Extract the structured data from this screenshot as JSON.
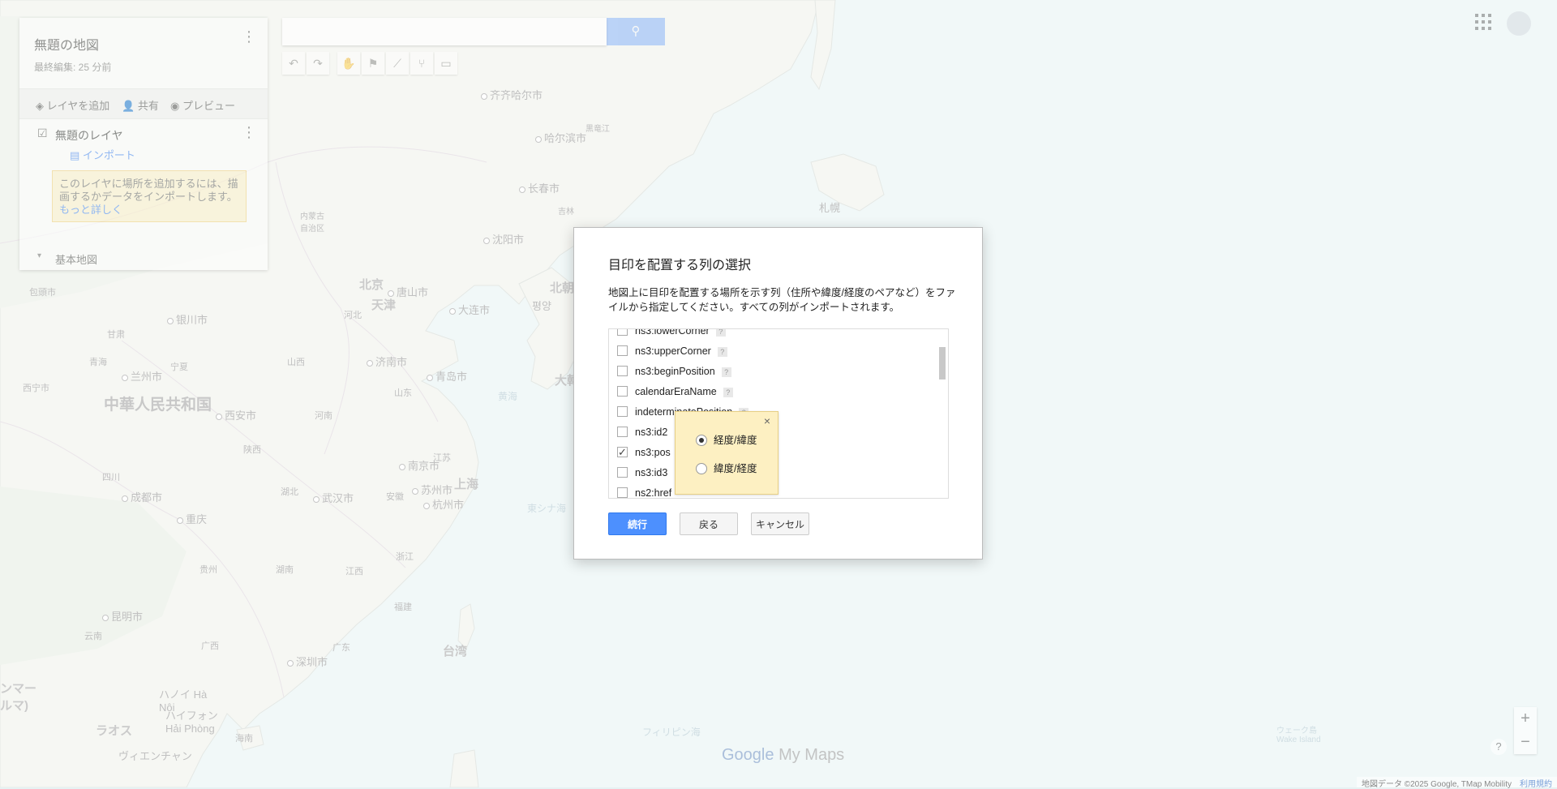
{
  "map": {
    "places": [
      {
        "label": "齐齐哈尔市"
      },
      {
        "label": "哈尔滨市"
      },
      {
        "label": "长春市"
      },
      {
        "label": "沈阳市"
      },
      {
        "label": "北京"
      },
      {
        "label": "天津"
      },
      {
        "label": "唐山市"
      },
      {
        "label": "大连市"
      },
      {
        "label": "银川市"
      },
      {
        "label": "兰州市"
      },
      {
        "label": "西安市"
      },
      {
        "label": "济南市"
      },
      {
        "label": "青岛市"
      },
      {
        "label": "南京市"
      },
      {
        "label": "苏州市"
      },
      {
        "label": "上海"
      },
      {
        "label": "杭州市"
      },
      {
        "label": "武汉市"
      },
      {
        "label": "成都市"
      },
      {
        "label": "重庆"
      },
      {
        "label": "昆明市"
      },
      {
        "label": "深圳市"
      },
      {
        "label": "台湾"
      },
      {
        "label": "札幌"
      },
      {
        "label": "평양"
      },
      {
        "label": "ハノイ Hà Nội"
      },
      {
        "label": "ハイフォン Hải Phòng"
      },
      {
        "label": "ラオス"
      },
      {
        "label": "ヴィエンチャン"
      },
      {
        "label": "フィリピン海"
      },
      {
        "label": "ウェーク島 Wake Island"
      },
      {
        "label": "内蒙古 自治区"
      },
      {
        "label": "吉林"
      },
      {
        "label": "黒竜江"
      },
      {
        "label": "北朝"
      },
      {
        "label": "大韓"
      },
      {
        "label": "東シナ海"
      },
      {
        "label": "黄海"
      },
      {
        "label": "海南"
      },
      {
        "label": "广西"
      },
      {
        "label": "贵州"
      },
      {
        "label": "湖南"
      },
      {
        "label": "江西"
      },
      {
        "label": "福建"
      },
      {
        "label": "广东"
      },
      {
        "label": "湖北"
      },
      {
        "label": "安徽"
      },
      {
        "label": "江苏"
      },
      {
        "label": "山西"
      },
      {
        "label": "河北"
      },
      {
        "label": "陕西"
      },
      {
        "label": "甘肃"
      },
      {
        "label": "宁夏"
      },
      {
        "label": "青海"
      },
      {
        "label": "四川"
      },
      {
        "label": "云南"
      },
      {
        "label": "浙江"
      },
      {
        "label": "山东"
      },
      {
        "label": "河南"
      },
      {
        "label": "包頭市"
      },
      {
        "label": "西宁市"
      }
    ],
    "country_label": "中華人民共和国",
    "myanmar_label": "ンマー\nルマ)",
    "brand_google": "Google",
    "brand_product": "My Maps",
    "attribution": "地図データ ©2025 Google, TMap Mobility",
    "terms": "利用規約",
    "zoom_in": "+",
    "zoom_out": "−",
    "help": "?"
  },
  "left_panel": {
    "map_title": "無題の地図",
    "last_edited": "最終編集: 25 分前",
    "add_layer": "レイヤを追加",
    "share": "共有",
    "preview": "プレビュー",
    "layer_title": "無題のレイヤ",
    "import": "インポート",
    "hint_text": "このレイヤに場所を追加するには、描画するかデータをインポートします。",
    "hint_link": "もっと詳しく",
    "base_map": "基本地図"
  },
  "search": {
    "placeholder": ""
  },
  "dialog": {
    "title": "目印を配置する列の選択",
    "description": "地図上に目印を配置する場所を示す列（住所や緯度/経度のペアなど）をファイルから指定してください。すべての列がインポートされます。",
    "columns": [
      {
        "name": "ns3:lowerCorner",
        "checked": false
      },
      {
        "name": "ns3:upperCorner",
        "checked": false
      },
      {
        "name": "ns3:beginPosition",
        "checked": false
      },
      {
        "name": "calendarEraName",
        "checked": false
      },
      {
        "name": "indeterminatePosition",
        "checked": false
      },
      {
        "name": "ns3:id2",
        "checked": false
      },
      {
        "name": "ns3:pos",
        "checked": true
      },
      {
        "name": "ns3:id3",
        "checked": false
      },
      {
        "name": "ns2:href",
        "checked": false
      }
    ],
    "popover": {
      "close": "×",
      "options": [
        {
          "label": "経度/緯度",
          "selected": true
        },
        {
          "label": "緯度/経度",
          "selected": false
        }
      ]
    },
    "continue": "続行",
    "back": "戻る",
    "cancel": "キャンセル"
  }
}
